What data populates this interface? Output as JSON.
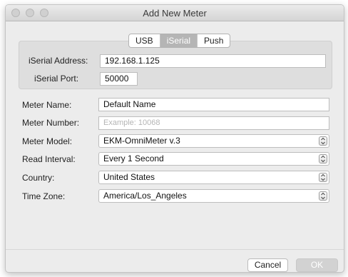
{
  "window": {
    "title": "Add New Meter"
  },
  "tabs": [
    {
      "label": "USB",
      "active": false
    },
    {
      "label": "iSerial",
      "active": true
    },
    {
      "label": "Push",
      "active": false
    }
  ],
  "iserial": {
    "address_label": "iSerial Address:",
    "address_value": "192.168.1.125",
    "port_label": "iSerial Port:",
    "port_value": "50000"
  },
  "form": {
    "meter_name_label": "Meter Name:",
    "meter_name_value": "Default Name",
    "meter_number_label": "Meter Number:",
    "meter_number_placeholder": "Example: 10068",
    "meter_model_label": "Meter Model:",
    "meter_model_value": "EKM-OmniMeter v.3",
    "read_interval_label": "Read Interval:",
    "read_interval_value": "Every 1 Second",
    "country_label": "Country:",
    "country_value": "United States",
    "time_zone_label": "Time Zone:",
    "time_zone_value": "America/Los_Angeles"
  },
  "buttons": {
    "cancel": "Cancel",
    "ok": "OK"
  },
  "icons": {
    "select_stepper": "updown-chevron-icon"
  }
}
